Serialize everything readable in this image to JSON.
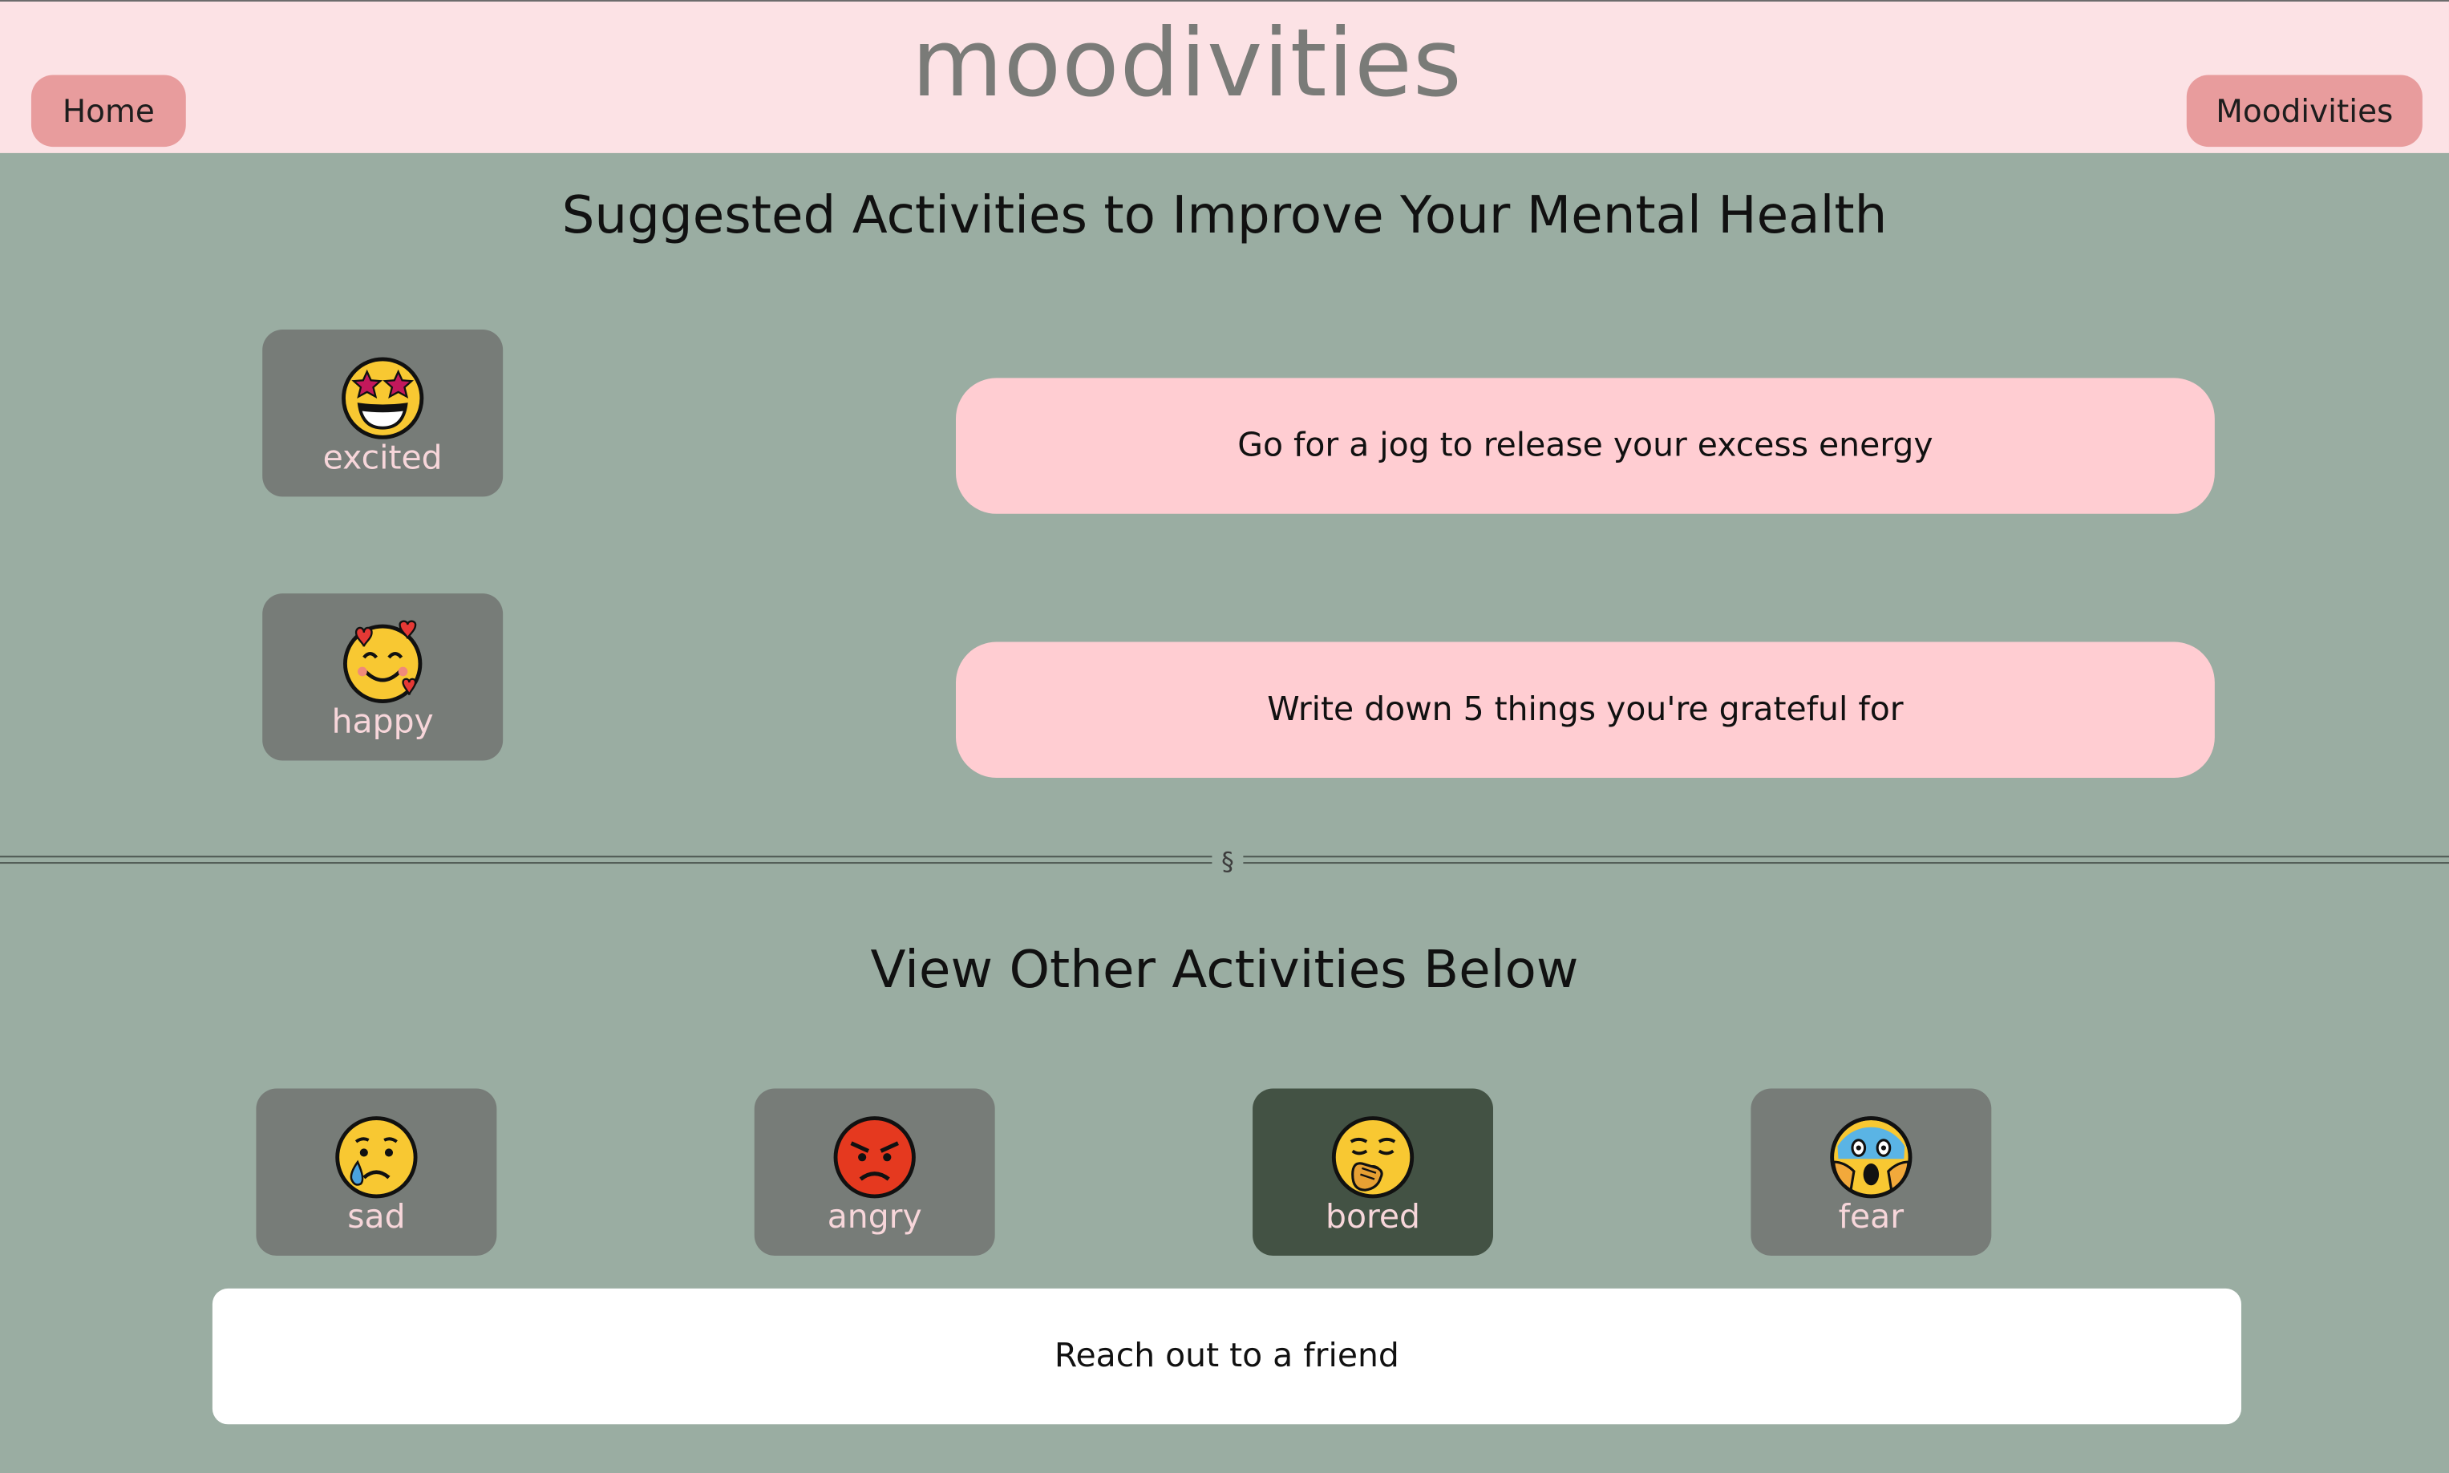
{
  "header": {
    "logo": "moodivities",
    "nav": [
      {
        "label": "Home"
      },
      {
        "label": "Moodivities"
      }
    ]
  },
  "suggested": {
    "title": "Suggested Activities to Improve Your Mental Health",
    "items": [
      {
        "mood": "excited",
        "icon": "star-struck-face-icon",
        "activity": "Go for a jog to release your excess energy"
      },
      {
        "mood": "happy",
        "icon": "smiling-face-with-hearts-icon",
        "activity": "Write down 5 things you're grateful for"
      }
    ]
  },
  "divider": {
    "symbol": "§"
  },
  "other": {
    "title": "View Other Activities Below",
    "moods": [
      {
        "label": "sad",
        "icon": "crying-face-icon",
        "active": false
      },
      {
        "label": "angry",
        "icon": "angry-face-icon",
        "active": false
      },
      {
        "label": "bored",
        "icon": "yawning-face-icon",
        "active": true
      },
      {
        "label": "fear",
        "icon": "screaming-face-icon",
        "active": false
      }
    ],
    "result": "Reach out to a friend"
  },
  "colors": {
    "page_bg": "#9aada2",
    "header_bg": "#fce2e5",
    "nav_button": "#e89c9d",
    "card_bg": "#777c78",
    "card_active": "#435244",
    "card_label": "#f7d6da",
    "activity_pill": "#ffcdd2",
    "result_bg": "#ffffff"
  }
}
